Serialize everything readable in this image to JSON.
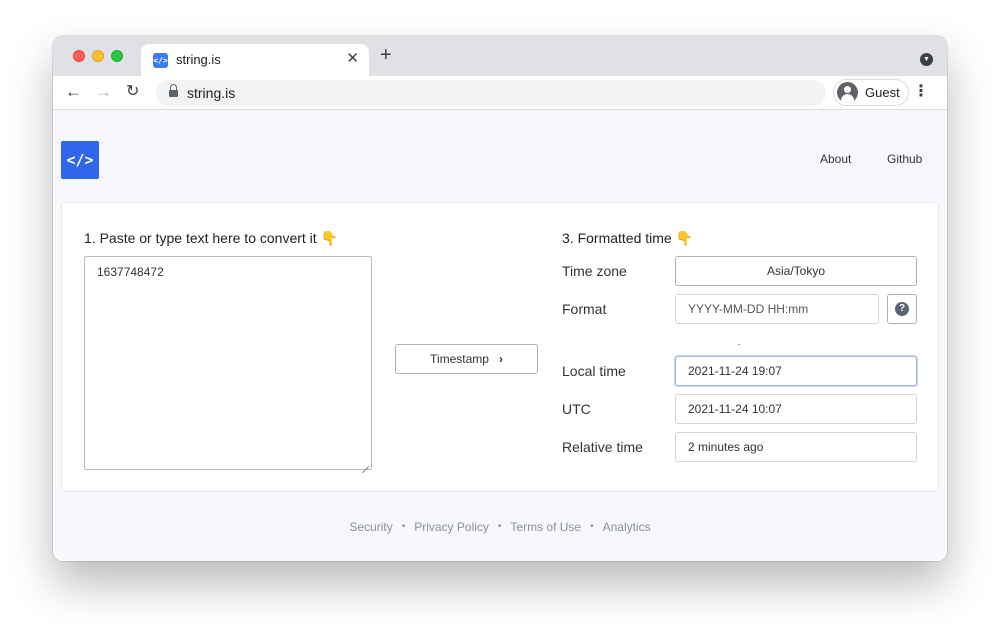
{
  "browser": {
    "tab": {
      "title": "string.is",
      "favicon": "</>"
    },
    "icons": {
      "close": "close-icon",
      "new_tab": "plus-icon",
      "tab_menu": "chevron-down-icon",
      "back": "arrow-left-icon",
      "forward": "arrow-right-icon",
      "reload": "reload-icon",
      "lock": "lock-icon",
      "menu": "kebab-menu-icon"
    },
    "new_tab_glyph": "+",
    "close_glyph": "✕",
    "back_glyph": "←",
    "forward_glyph": "→",
    "reload_glyph": "↻",
    "menu_glyph": "⋮",
    "tab_menu_glyph": "▼",
    "url": "string.is",
    "profile": {
      "label": "Guest"
    }
  },
  "site": {
    "logo": "</>",
    "nav": {
      "about": "About",
      "github": "Github"
    },
    "colors": {
      "brand": "#2f66ea"
    }
  },
  "converter": {
    "input_heading": "1. Paste or type text here to convert it 👇",
    "input_value": "1637748472",
    "convert_button": {
      "label": "Timestamp",
      "chevron": "›"
    },
    "output_heading": "3. Formatted time 👇",
    "fields": {
      "timezone": {
        "label": "Time zone",
        "value": "Asia/Tokyo"
      },
      "format": {
        "label": "Format",
        "placeholder": "YYYY-MM-DD HH:mm",
        "help": "?"
      },
      "local_time": {
        "label": "Local time",
        "value": "2021-11-24 19:07"
      },
      "utc": {
        "label": "UTC",
        "value": "2021-11-24 10:07"
      },
      "relative_time": {
        "label": "Relative time",
        "value": "2 minutes ago"
      }
    }
  },
  "footer": {
    "links": [
      "Security",
      "Privacy Policy",
      "Terms of Use",
      "Analytics"
    ],
    "separator": "•"
  }
}
